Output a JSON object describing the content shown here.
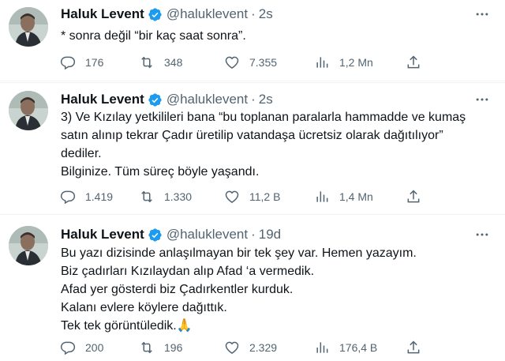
{
  "tweets": [
    {
      "name": "Haluk Levent",
      "handle": "@haluklevent",
      "dot": "·",
      "time": "2s",
      "lines": [
        "* sonra değil “bir kaç saat sonra”."
      ],
      "replies": "176",
      "retweets": "348",
      "likes": "7.355",
      "views": "1,2 Mn"
    },
    {
      "name": "Haluk Levent",
      "handle": "@haluklevent",
      "dot": "·",
      "time": "2s",
      "lines": [
        "3) Ve Kızılay yetkilileri bana “bu toplanan paralarla hammadde ve kumaş",
        "satın alınıp tekrar Çadır üretilip vatandaşa ücretsiz olarak dağıtılıyor”",
        "dediler.",
        "Bilginize. Tüm süreç böyle yaşandı."
      ],
      "replies": "1.419",
      "retweets": "1.330",
      "likes": "11,2 B",
      "views": "1,4 Mn"
    },
    {
      "name": "Haluk Levent",
      "handle": "@haluklevent",
      "dot": "·",
      "time": "19d",
      "lines": [
        "Bu yazı dizisinde anlaşılmayan bir tek şey var. Hemen yazayım.",
        "Biz çadırları Kızılaydan alıp Afad ‘a vermedik.",
        "Afad yer gösterdi biz Çadırkentler kurduk.",
        "Kalanı evlere köylere dağıttık.",
        "Tek tek görüntüledik.🙏"
      ],
      "replies": "200",
      "retweets": "196",
      "likes": "2.329",
      "views": "176,4 B"
    }
  ],
  "icons": {
    "verified": "verified-badge-icon",
    "more": "more-dots-icon",
    "reply": "reply-bubble-icon",
    "retweet": "retweet-icon",
    "like": "heart-icon",
    "views": "views-bar-chart-icon",
    "share": "share-upload-icon"
  },
  "colors": {
    "accent": "#1d9bf0",
    "text": "#0f1419",
    "secondary": "#536471",
    "divider": "#eff3f4"
  }
}
